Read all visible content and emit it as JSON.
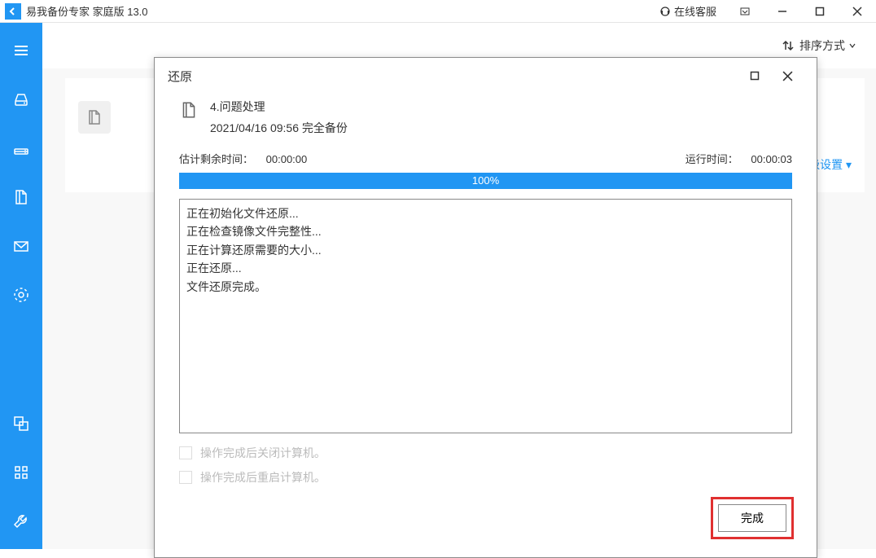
{
  "titlebar": {
    "app_title": "易我备份专家 家庭版 13.0",
    "online_service": "在线客服"
  },
  "topbar": {
    "sort_label": "排序方式"
  },
  "bg_card": {
    "advanced_label": "高级设置"
  },
  "dialog": {
    "title": "还原",
    "header": {
      "task_name": "4.问题处理",
      "backup_info": "2021/04/16 09:56 完全备份"
    },
    "times": {
      "est_label": "估计剩余时间：",
      "est_value": "00:00:00",
      "run_label": "运行时间：",
      "run_value": "00:00:03"
    },
    "progress_text": "100%",
    "log_lines": [
      "正在初始化文件还原...",
      "正在检查镜像文件完整性...",
      "正在计算还原需要的大小...",
      "正在还原...",
      "文件还原完成。"
    ],
    "checkbox1": "操作完成后关闭计算机。",
    "checkbox2": "操作完成后重启计算机。",
    "finish_label": "完成"
  }
}
